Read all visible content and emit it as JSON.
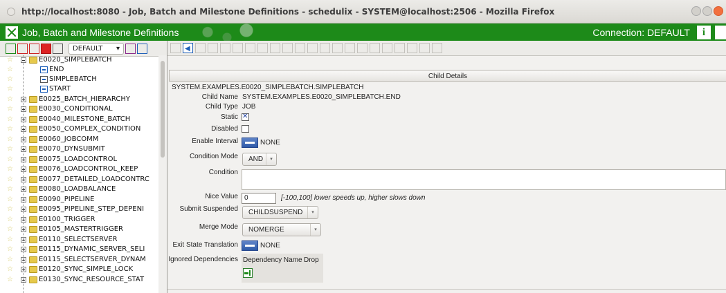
{
  "browser": {
    "title": "http://localhost:8080 - Job, Batch and Milestone Definitions - schedulix - SYSTEM@localhost:2506 - Mozilla Firefox"
  },
  "app": {
    "title": "Job, Batch and Milestone Definitions",
    "connection": "Connection: DEFAULT",
    "info_icon": "info-icon",
    "brand_color": "#1d8a19"
  },
  "left_toolbar": {
    "select_value": "DEFAULT",
    "select_arrow": "▾"
  },
  "tree": {
    "items": [
      {
        "label": "E0020_SIMPLEBATCH",
        "expanded": true
      },
      {
        "label": "END",
        "type": "job"
      },
      {
        "label": "SIMPLEBATCH",
        "type": "batch"
      },
      {
        "label": "START",
        "type": "job"
      },
      {
        "label": "E0025_BATCH_HIERARCHY"
      },
      {
        "label": "E0030_CONDITIONAL"
      },
      {
        "label": "E0040_MILESTONE_BATCH"
      },
      {
        "label": "E0050_COMPLEX_CONDITION"
      },
      {
        "label": "E0060_JOBCOMM"
      },
      {
        "label": "E0070_DYNSUBMIT"
      },
      {
        "label": "E0075_LOADCONTROL"
      },
      {
        "label": "E0076_LOADCONTROL_KEEP"
      },
      {
        "label": "E0077_DETAILED_LOADCONTRC"
      },
      {
        "label": "E0080_LOADBALANCE"
      },
      {
        "label": "E0090_PIPELINE"
      },
      {
        "label": "E0095_PIPELINE_STEP_DEPENI"
      },
      {
        "label": "E0100_TRIGGER"
      },
      {
        "label": "E0105_MASTERTRIGGER"
      },
      {
        "label": "E0110_SELECTSERVER"
      },
      {
        "label": "E0115_DYNAMIC_SERVER_SELI"
      },
      {
        "label": "E0115_SELECTSERVER_DYNAM"
      },
      {
        "label": "E0120_SYNC_SIMPLE_LOCK"
      },
      {
        "label": "E0130_SYNC_RESOURCE_STAT"
      }
    ]
  },
  "detail": {
    "header": "Child Details",
    "path": "SYSTEM.EXAMPLES.E0020_SIMPLEBATCH.SIMPLEBATCH",
    "child_name_label": "Child Name",
    "child_name": "SYSTEM.EXAMPLES.E0020_SIMPLEBATCH.END",
    "child_type_label": "Child Type",
    "child_type": "JOB",
    "static_label": "Static",
    "static_checked": true,
    "disabled_label": "Disabled",
    "disabled_checked": false,
    "enable_interval_label": "Enable Interval",
    "enable_interval_value": "NONE",
    "condition_mode_label": "Condition Mode",
    "condition_mode_value": "AND",
    "condition_label": "Condition",
    "condition_value": "",
    "nice_value_label": "Nice Value",
    "nice_value": "0",
    "nice_hint": "[-100,100] lower speeds up, higher slows down",
    "submit_suspended_label": "Submit Suspended",
    "submit_suspended_value": "CHILDSUSPEND",
    "merge_mode_label": "Merge Mode",
    "merge_mode_value": "NOMERGE",
    "exit_state_label": "Exit State Translation",
    "exit_state_value": "NONE",
    "ignored_deps_label": "Ignored Dependencies",
    "dep_col_name": "Dependency Name",
    "dep_col_drop": "Drop",
    "dropdown_arrow": "▾"
  }
}
